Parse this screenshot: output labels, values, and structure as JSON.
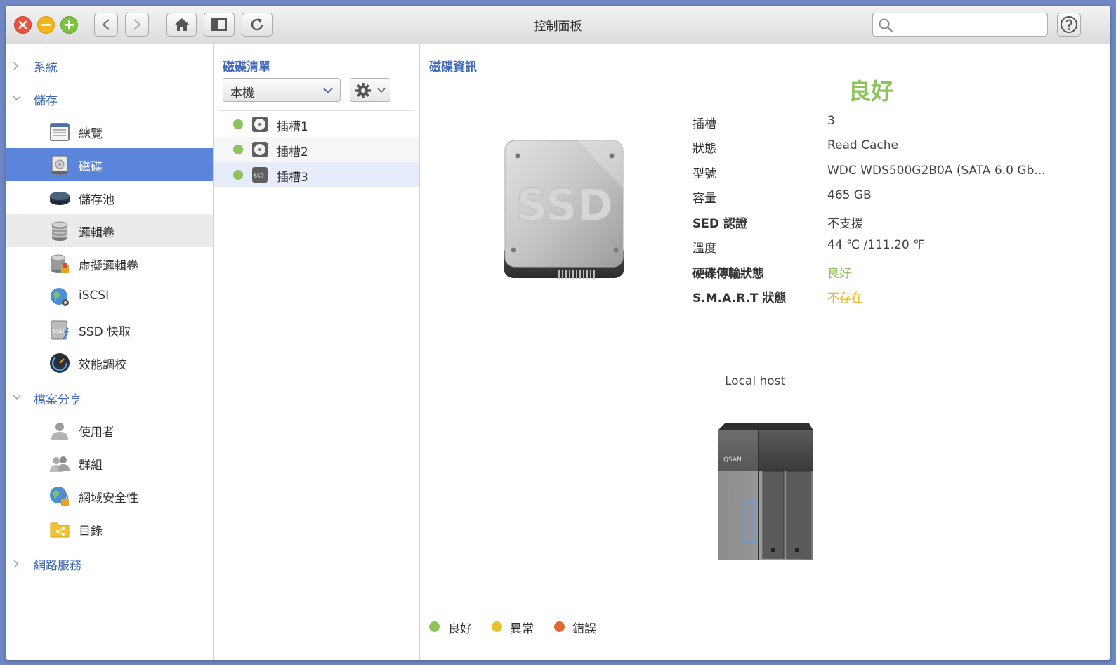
{
  "window": {
    "title": "控制面板"
  },
  "search": {
    "placeholder": "",
    "value": ""
  },
  "sidebar": {
    "categories": [
      {
        "label": "系統",
        "expanded": false
      },
      {
        "label": "儲存",
        "expanded": true
      },
      {
        "label": "檔案分享",
        "expanded": true
      },
      {
        "label": "網路服務",
        "expanded": false
      }
    ],
    "storage_items": [
      {
        "label": "總覽",
        "icon": "overview-icon"
      },
      {
        "label": "磁碟",
        "icon": "disk-icon",
        "selected": true
      },
      {
        "label": "儲存池",
        "icon": "storage-pool-icon"
      },
      {
        "label": "邏輯卷",
        "icon": "logical-volume-icon",
        "hover": true
      },
      {
        "label": "虛擬邏輯卷",
        "icon": "virtual-volume-icon"
      },
      {
        "label": "iSCSI",
        "icon": "iscsi-globe-icon"
      },
      {
        "label": "SSD 快取",
        "icon": "ssd-cache-icon"
      },
      {
        "label": "效能調校",
        "icon": "performance-gauge-icon"
      }
    ],
    "sharing_items": [
      {
        "label": "使用者",
        "icon": "user-icon"
      },
      {
        "label": "群組",
        "icon": "group-icon"
      },
      {
        "label": "網域安全性",
        "icon": "domain-security-icon"
      },
      {
        "label": "目錄",
        "icon": "directory-folder-icon"
      }
    ]
  },
  "disk_list": {
    "title": "磁碟清單",
    "host_select": "本機",
    "slots": [
      {
        "label": "插槽1",
        "status": "good",
        "type": "hdd"
      },
      {
        "label": "插槽2",
        "status": "good",
        "type": "hdd"
      },
      {
        "label": "插槽3",
        "status": "good",
        "type": "ssd",
        "selected": true
      }
    ]
  },
  "disk_info": {
    "title": "磁碟資訊",
    "ssd_image_text": "SSD",
    "status": "良好",
    "fields": [
      {
        "label": "插槽",
        "value": "3"
      },
      {
        "label": "狀態",
        "value": "Read Cache"
      },
      {
        "label": "型號",
        "value": "WDC WDS500G2B0A (SATA 6.0 Gb..."
      },
      {
        "label": "容量",
        "value": "465 GB"
      },
      {
        "label": "SED 認證",
        "value": "不支援",
        "label_bold": true
      },
      {
        "label": "溫度",
        "value": "44 ℃ /111.20 ℉"
      },
      {
        "label": "硬碟傳輸狀態",
        "value": "良好",
        "label_bold": true,
        "value_style": "good"
      },
      {
        "label": "S.M.A.R.T 狀態",
        "value": "不存在",
        "label_bold": true,
        "value_style": "warn"
      }
    ],
    "host_label": "Local host",
    "nas_brand": "QSAN"
  },
  "legend": [
    {
      "label": "良好",
      "color": "#8cc35a"
    },
    {
      "label": "異常",
      "color": "#e8c22a"
    },
    {
      "label": "錯誤",
      "color": "#e0692f"
    }
  ],
  "colors": {
    "accent": "#5b85da",
    "link": "#3e67b8",
    "good": "#8cc35a",
    "warn": "#e8b51e",
    "error": "#e0692f"
  }
}
